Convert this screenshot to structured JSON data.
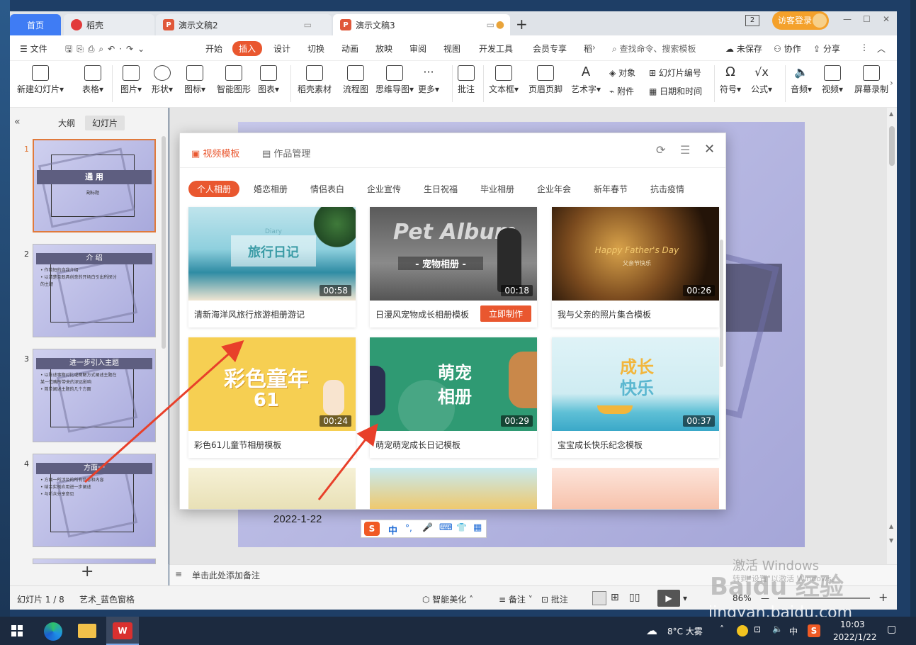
{
  "titlebar": {
    "tabs": [
      {
        "label": "首页"
      },
      {
        "label": "稻壳"
      },
      {
        "label": "演示文稿2"
      },
      {
        "label": "演示文稿3"
      }
    ],
    "new_tab": "+",
    "badge": "2",
    "login": "访客登录",
    "controls": [
      "—",
      "☐",
      "✕"
    ]
  },
  "menubar": {
    "file": "文件",
    "items": [
      "开始",
      "插入",
      "设计",
      "切换",
      "动画",
      "放映",
      "审阅",
      "视图",
      "开发工具",
      "会员专享",
      "稻"
    ],
    "search_placeholder": "查找命令、搜索模板",
    "unsaved": "未保存",
    "collab": "协作",
    "share": "分享"
  },
  "ribbon": {
    "buttons": [
      "新建幻灯片",
      "表格",
      "图片",
      "形状",
      "图标",
      "智能图形",
      "图表",
      "稻壳素材",
      "流程图",
      "思维导图",
      "更多",
      "批注",
      "文本框",
      "页眉页脚",
      "艺术字"
    ],
    "small": [
      "对象",
      "幻灯片编号",
      "附件",
      "日期和时间"
    ],
    "right_buttons": [
      "符号",
      "公式",
      "音频",
      "视频",
      "屏幕录制"
    ]
  },
  "leftpanel": {
    "tab_outline": "大纲",
    "tab_slides": "幻灯片",
    "slides": [
      {
        "num": "1",
        "title": "通 用",
        "sub": "副标题",
        "bullets": []
      },
      {
        "num": "2",
        "title": "介 绍",
        "bullets": [
          "• 作简短的自我介绍",
          "• 以清楚且既具创意的开场白引出所探讨",
          "  的主题"
        ]
      },
      {
        "num": "3",
        "title": "进一步引入主题",
        "bullets": [
          "• 以陈述事物对比或图解方式阐述主题在",
          "  某一范畴所带来的深远影响",
          "• 简单阐述主题的几个方面"
        ]
      },
      {
        "num": "4",
        "title": "方面一",
        "bullets": [
          "• 方面一所涉及的所有信息和内容",
          "• 结合实例应用进一步阐述",
          "• 与听众分享意见"
        ]
      }
    ],
    "add": "+"
  },
  "dialog": {
    "tab_video": "视频模板",
    "tab_works": "作品管理",
    "categories": [
      "个人相册",
      "婚恋相册",
      "情侣表白",
      "企业宣传",
      "生日祝福",
      "毕业相册",
      "企业年会",
      "新年春节",
      "抗击疫情"
    ],
    "cards": [
      {
        "caption": "清新海洋风旅行旅游相册游记",
        "duration": "00:58",
        "art_title": "旅行日记",
        "art_sub": "Diary"
      },
      {
        "caption": "日漫风宠物成长相册模板",
        "duration": "00:18",
        "art_title": "Pet Album",
        "art_sub": "- 宠物相册 -",
        "action": "立即制作"
      },
      {
        "caption": "我与父亲的照片集合模板",
        "duration": "00:26",
        "art_title": "Happy Father's Day",
        "art_sub": "父亲节快乐"
      },
      {
        "caption": "彩色61儿童节相册模板",
        "duration": "00:24",
        "art_title": "彩色童年",
        "art_sub": "61"
      },
      {
        "caption": "萌宠萌宠成长日记模板",
        "duration": "00:29",
        "art_title": "萌宠",
        "art_sub": "相册"
      },
      {
        "caption": "宝宝成长快乐纪念模板",
        "duration": "00:37",
        "art_title": "成长",
        "art_sub": "快乐"
      }
    ]
  },
  "slide": {
    "date": "2022-1-22"
  },
  "ime": {
    "items": [
      "S",
      "中",
      "°,",
      "🎤",
      "⌨",
      "👕",
      "▦"
    ]
  },
  "notes": {
    "placeholder": "单击此处添加备注"
  },
  "status": {
    "slide_count": "幻灯片 1 / 8",
    "theme": "艺术_蓝色窗格",
    "beautify": "智能美化",
    "notes_btn": "备注",
    "comment_btn": "批注",
    "zoom": "86%"
  },
  "watermark": {
    "activate": "激活 Windows",
    "activate_sub": "转到\"设置\"以激活 Windows。",
    "brand": "Baidu 经验",
    "url": "jingyan.baidu.com"
  },
  "taskbar": {
    "weather": "8°C 大雾",
    "ime": "中",
    "time": "10:03",
    "date": "2022/1/22"
  },
  "colors": {
    "accent": "#e9572f",
    "home_tab": "#3f7cf4",
    "slide_bg": "#b4b5e2",
    "arrow": "#e8402a"
  }
}
